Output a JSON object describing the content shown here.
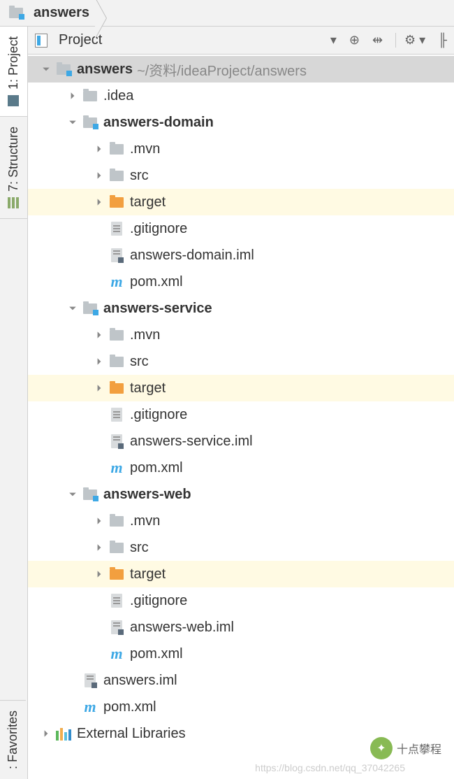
{
  "breadcrumb": {
    "root": "answers"
  },
  "sidebar": {
    "project": "1: Project",
    "structure": "7: Structure",
    "favorites": ": Favorites"
  },
  "panel": {
    "title": "Project"
  },
  "tree": {
    "root": {
      "name": "answers",
      "path": "~/资料/ideaProject/answers"
    },
    "idea": ".idea",
    "mod1": {
      "name": "answers-domain",
      "mvn": ".mvn",
      "src": "src",
      "target": "target",
      "git": ".gitignore",
      "iml": "answers-domain.iml",
      "pom": "pom.xml"
    },
    "mod2": {
      "name": "answers-service",
      "mvn": ".mvn",
      "src": "src",
      "target": "target",
      "git": ".gitignore",
      "iml": "answers-service.iml",
      "pom": "pom.xml"
    },
    "mod3": {
      "name": "answers-web",
      "mvn": ".mvn",
      "src": "src",
      "target": "target",
      "git": ".gitignore",
      "iml": "answers-web.iml",
      "pom": "pom.xml"
    },
    "rootiml": "answers.iml",
    "rootpom": "pom.xml",
    "extlib": "External Libraries"
  },
  "watermark": {
    "text": "十点攀程",
    "url": "https://blog.csdn.net/qq_37042265"
  }
}
